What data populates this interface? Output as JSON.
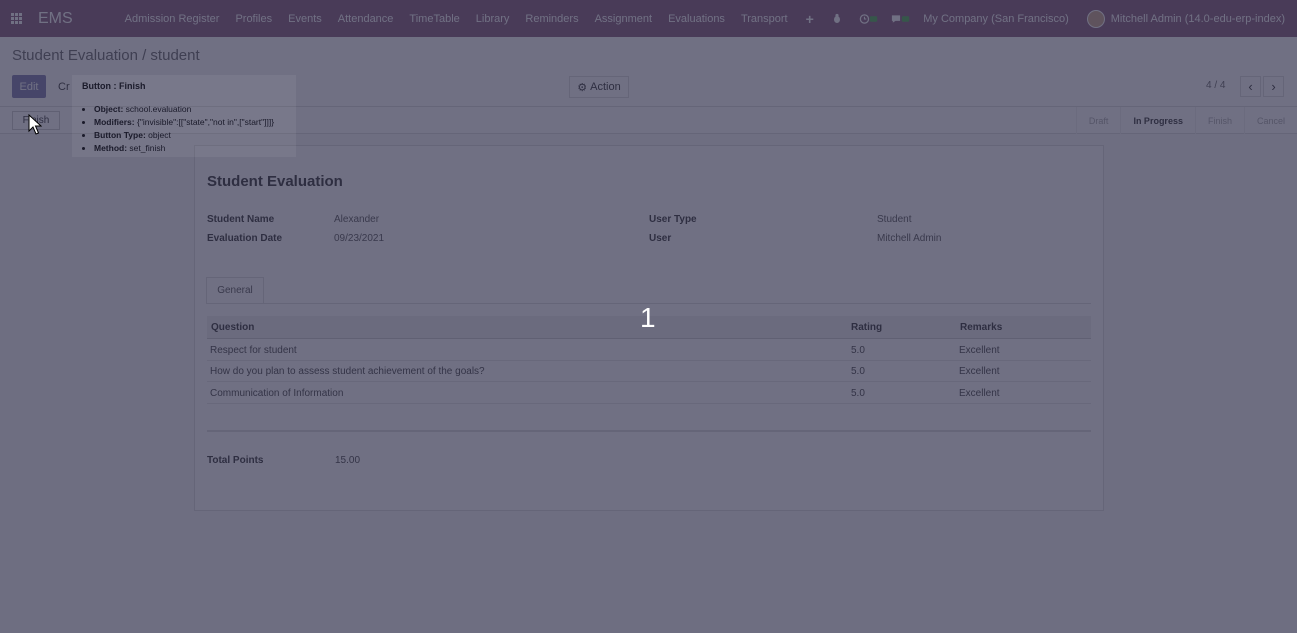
{
  "navbar": {
    "brand": "EMS",
    "menu": [
      "Admission Register",
      "Profiles",
      "Events",
      "Attendance",
      "TimeTable",
      "Library",
      "Reminders",
      "Assignment",
      "Evaluations",
      "Transport"
    ],
    "plus": "+",
    "company": "My Company (San Francisco)",
    "user": "Mitchell Admin (14.0-edu-erp-index)"
  },
  "control": {
    "breadcrumb": "Student Evaluation / student",
    "edit_label": "Edit",
    "create_label": "Cr",
    "action_label": "Action",
    "pager": "4 / 4"
  },
  "statusbar": {
    "finish_label": "Finish",
    "stages": [
      "Draft",
      "In Progress",
      "Finish",
      "Cancel"
    ],
    "active_stage": "In Progress"
  },
  "sheet": {
    "title": "Student Evaluation",
    "fields": {
      "student_name_label": "Student Name",
      "student_name": "Alexander",
      "evaluation_date_label": "Evaluation Date",
      "evaluation_date": "09/23/2021",
      "user_type_label": "User Type",
      "user_type": "Student",
      "user_label": "User",
      "user": "Mitchell Admin"
    },
    "tab": "General",
    "table": {
      "headers": [
        "Question",
        "Rating",
        "Remarks"
      ],
      "rows": [
        {
          "question": "Respect for student",
          "rating": "5.0",
          "remarks": "Excellent"
        },
        {
          "question": "How do you plan to assess student achievement of the goals?",
          "rating": "5.0",
          "remarks": "Excellent"
        },
        {
          "question": "Communication of Information",
          "rating": "5.0",
          "remarks": "Excellent"
        }
      ]
    },
    "total_label": "Total Points",
    "total_value": "15.00"
  },
  "tooltip": {
    "title": "Button : Finish",
    "items": [
      {
        "key": "Object:",
        "value": "school.evaluation"
      },
      {
        "key": "Modifiers:",
        "value": "{\"invisible\":[[\"state\",\"not in\",[\"start\"]]]}"
      },
      {
        "key": "Button Type:",
        "value": "object"
      },
      {
        "key": "Method:",
        "value": "set_finish"
      }
    ]
  },
  "step_number": "1"
}
